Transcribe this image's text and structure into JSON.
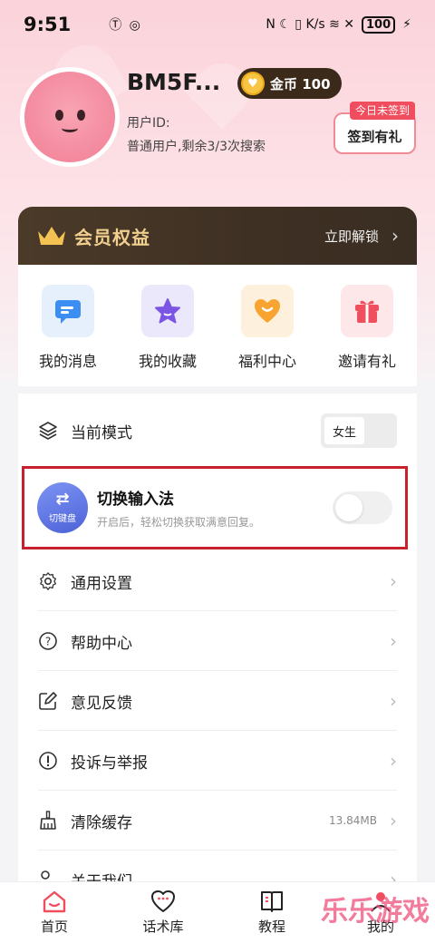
{
  "status_bar": {
    "time": "9:51",
    "mid_icons": "Ⓣ ◎",
    "right_icons": "N ☾ ▯ K/s ≋ ✕",
    "battery": "100"
  },
  "profile": {
    "username": "BM5F...",
    "coin_label": "金币 100",
    "user_id_label": "用户ID:",
    "user_status": "普通用户,剩余3/3次搜索",
    "signin_tag": "今日未签到",
    "signin_button": "签到有礼"
  },
  "vip": {
    "title": "会员权益",
    "unlock_label": "立即解锁"
  },
  "quick_actions": [
    {
      "label": "我的消息",
      "icon": "message-icon",
      "bg": "#e6f0fc"
    },
    {
      "label": "我的收藏",
      "icon": "star-icon",
      "bg": "#ece8fb"
    },
    {
      "label": "福利中心",
      "icon": "heart-icon",
      "bg": "#fdf0dc"
    },
    {
      "label": "邀请有礼",
      "icon": "gift-icon",
      "bg": "#fde7e9"
    }
  ],
  "settings": {
    "mode_label": "当前模式",
    "mode_value": "女生",
    "ime_title": "切换输入法",
    "ime_desc": "开启后，轻松切换获取满意回复。",
    "ime_icon_text": "切键盘",
    "general": "通用设置",
    "help": "帮助中心",
    "feedback": "意见反馈",
    "report": "投诉与举报",
    "clear_cache": "清除缓存",
    "cache_size": "13.84MB",
    "about": "关于我们"
  },
  "nav": [
    {
      "label": "首页",
      "icon": "home-icon"
    },
    {
      "label": "话术库",
      "icon": "chat-heart-icon"
    },
    {
      "label": "教程",
      "icon": "book-icon"
    },
    {
      "label": "我的",
      "icon": "profile-icon"
    }
  ],
  "watermark": "乐乐游戏",
  "colors": {
    "accent": "#f04e5e",
    "vip_gold": "#f0cf8f",
    "highlight_border": "#c8202c"
  }
}
